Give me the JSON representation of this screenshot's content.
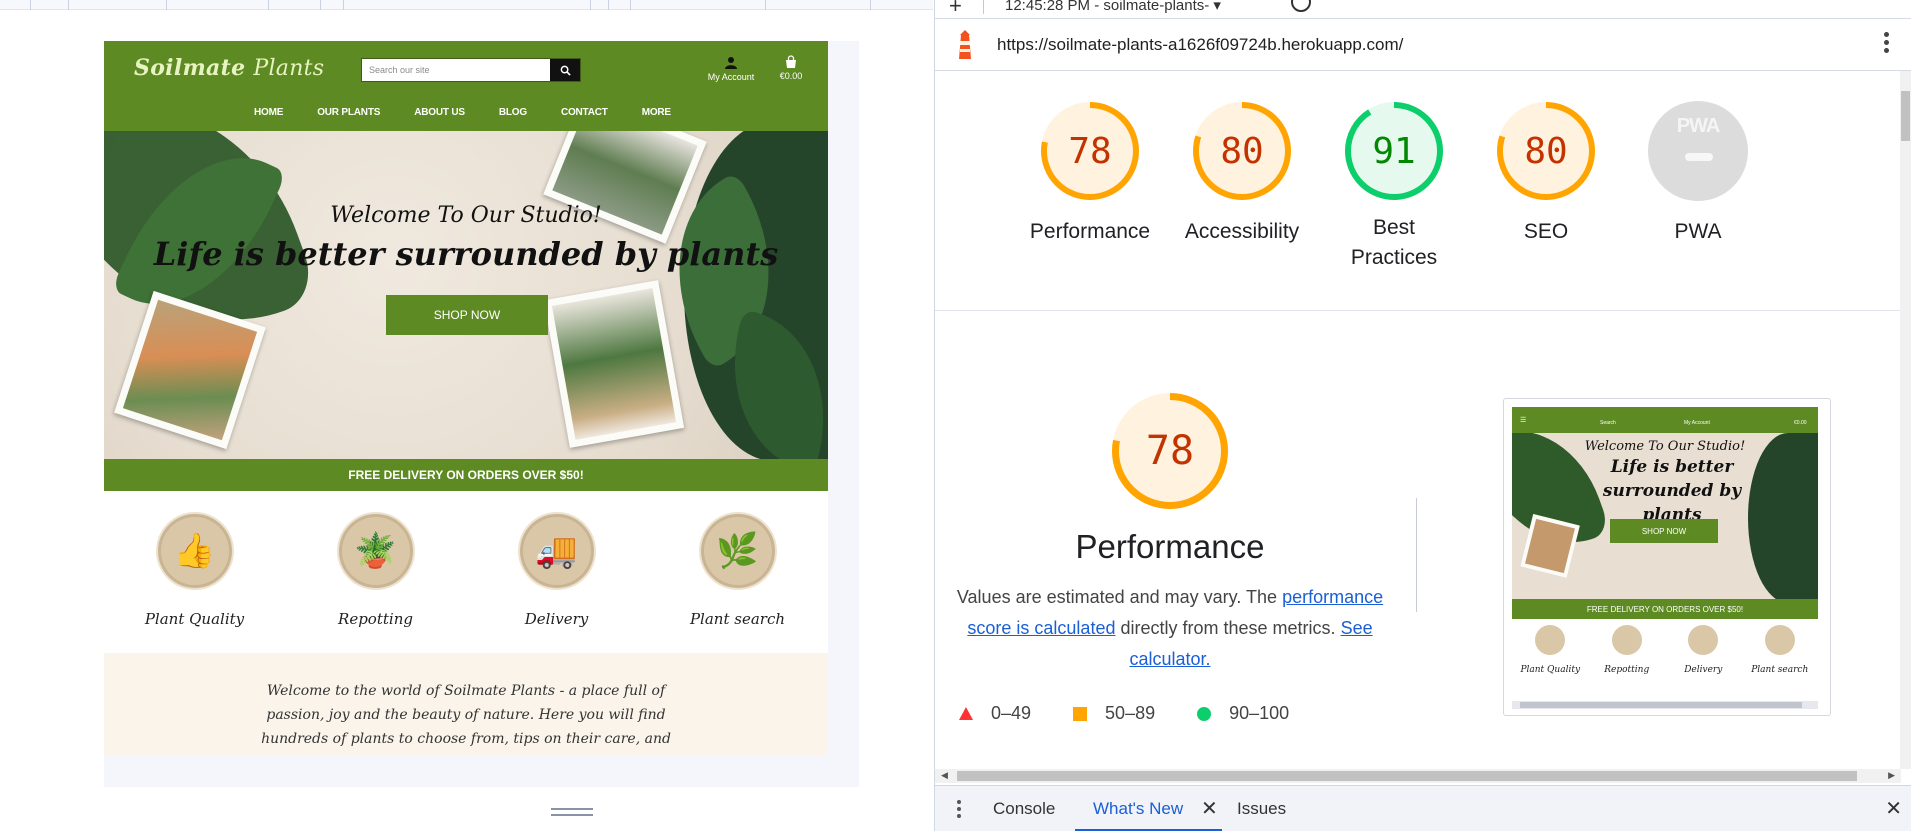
{
  "site": {
    "logo_part1": "Soilmate",
    "logo_part2": "Plants",
    "search_placeholder": "Search our site",
    "account_label": "My Account",
    "bag_total": "€0.00",
    "nav": [
      "HOME",
      "OUR PLANTS",
      "ABOUT US",
      "BLOG",
      "CONTACT",
      "MORE"
    ],
    "hero_kicker": "Welcome To Our Studio!",
    "hero_title": "Life is better surrounded by plants",
    "shop_button": "SHOP NOW",
    "promo": "FREE DELIVERY ON ORDERS OVER $50!",
    "features": [
      "Plant Quality",
      "Repotting",
      "Delivery",
      "Plant search"
    ],
    "welcome_text": "Welcome to the world of Soilmate Plants - a place full of passion, joy and the beauty of nature. Here you will find hundreds of plants to choose from, tips on their care, and inspiration for interior design"
  },
  "devtools": {
    "tab_label": "12:45:28 PM - soilmate-plants-",
    "url": "https://soilmate-plants-a1626f09724b.herokuapp.com/",
    "scores": [
      {
        "label": "Performance",
        "value": "78",
        "level": 0.78,
        "color": "#ffa400",
        "text_color": "#c33300",
        "bg": "#fff3e0"
      },
      {
        "label": "Accessibility",
        "value": "80",
        "level": 0.8,
        "color": "#ffa400",
        "text_color": "#c33300",
        "bg": "#fff3e0"
      },
      {
        "label": "Best Practices",
        "value": "91",
        "level": 0.91,
        "color": "#0cce6b",
        "text_color": "#008800",
        "bg": "#e6f9ee"
      },
      {
        "label": "SEO",
        "value": "80",
        "level": 0.8,
        "color": "#ffa400",
        "text_color": "#c33300",
        "bg": "#fff3e0"
      }
    ],
    "pwa_label": "PWA",
    "pwa_badge": "PWA",
    "performance": {
      "score": "78",
      "level": 0.78,
      "title": "Performance",
      "desc_prefix": "Values are estimated and may vary. The",
      "link1": "performance score is calculated",
      "desc_middle": "directly from these metrics.",
      "link2": "See calculator."
    },
    "legend": [
      "0–49",
      "50–89",
      "90–100"
    ],
    "thumb": {
      "kicker": "Welcome To Our Studio!",
      "title": "Life is better surrounded by plants",
      "button": "SHOP NOW",
      "promo": "FREE DELIVERY ON ORDERS OVER $50!",
      "features": [
        "Plant Quality",
        "Repotting",
        "Delivery",
        "Plant search"
      ],
      "search_label": "Search",
      "account_label": "My Account",
      "bag_total": "€0.00"
    },
    "drawer_tabs": [
      "Console",
      "What's New",
      "Issues"
    ]
  }
}
